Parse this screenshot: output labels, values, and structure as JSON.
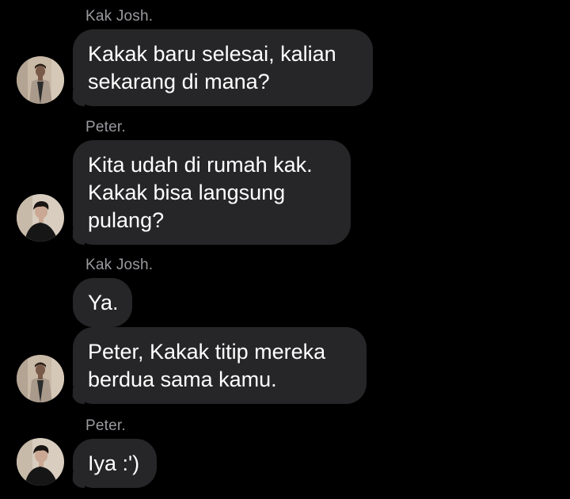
{
  "messages": [
    {
      "sender": "Kak Josh.",
      "text": "Kakak baru selesai, kalian sekarang di mana?",
      "line1": "Kakak baru selesai, kalian",
      "line2": "sekarang di mana?"
    },
    {
      "sender": "Peter.",
      "line1": "Kita udah di rumah kak.",
      "line2": "Kakak bisa langsung",
      "line3": "pulang?"
    },
    {
      "sender": "Kak Josh.",
      "line1": "Ya."
    },
    {
      "line1": "Peter, Kakak titip mereka",
      "line2": "berdua sama kamu."
    },
    {
      "sender": "Peter.",
      "line1": "Iya :')"
    }
  ],
  "avatars": {
    "josh": {
      "icon": "avatar-kak-josh",
      "colors": {
        "bg": "#c9b9a7",
        "jacket": "#a99a8c",
        "shirt": "#2b2b2b",
        "skin": "#7a5a48"
      }
    },
    "peter": {
      "icon": "avatar-peter",
      "colors": {
        "bg": "#d8cdbf",
        "shirt": "#161616",
        "skin": "#caa893",
        "hair": "#1a1512"
      }
    }
  },
  "theme": {
    "background": "#000000",
    "bubble": "#262628",
    "sender_label": "#9a9a9f",
    "text": "#ffffff"
  }
}
